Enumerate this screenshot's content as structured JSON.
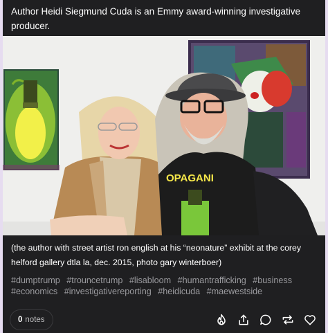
{
  "post": {
    "headline": "Author Heidi Siegmund Cuda is an Emmy award-winning investigative producer.",
    "caption": "(the author with street artist ron english at his “neonature” exhibit at the corey helford gallery dtla la, dec. 2015, photo gary winterboer)",
    "shirt_text": "OPAGANI",
    "tags": [
      "#dumptrump",
      "#trouncetrump",
      "#lisabloom",
      "#humantrafficking",
      "#business",
      "#economics",
      "#investigativereporting",
      "#heidicuda",
      "#maewestside"
    ],
    "notes": {
      "count": "0",
      "label": "notes"
    },
    "actions": [
      "flame-icon",
      "share-icon",
      "reply-icon",
      "reblog-icon",
      "heart-icon"
    ]
  },
  "colors": {
    "background": "#e6dcf0",
    "post_bg": "#1f1f21",
    "tag_text": "#9a9a9e"
  }
}
